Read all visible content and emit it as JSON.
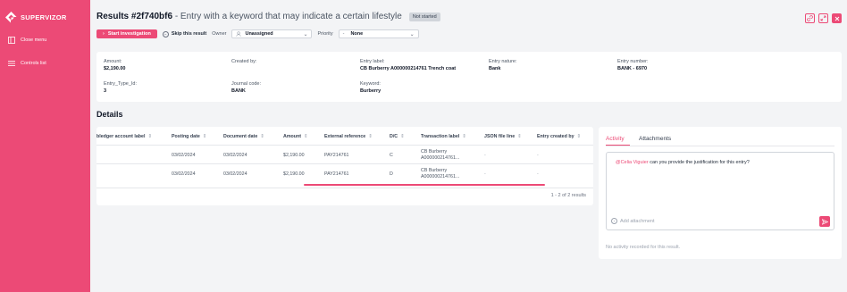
{
  "sidebar": {
    "brand": "SUPERVIZOR",
    "items": [
      {
        "label": "Close menu",
        "icon": "panel-close-icon"
      },
      {
        "label": "Controls list",
        "icon": "list-icon"
      }
    ]
  },
  "header": {
    "title_id": "Results #2f740bf6",
    "title_desc": "- Entry with a keyword that may indicate a certain lifestyle",
    "status": "Not started"
  },
  "actions": {
    "start": "Start investigation",
    "skip": "Skip this result",
    "owner_label": "Owner",
    "owner_value": "Unassigned",
    "priority_label": "Priority",
    "priority_value": "None",
    "priority_dash": "-"
  },
  "info": {
    "amount_label": "Amount:",
    "amount": "$2,190.00",
    "created_by_label": "Created by:",
    "created_by": "",
    "entry_label_label": "Entry label:",
    "entry_label": "CB Burberry A000000214761 Trench coat",
    "entry_nature_label": "Entry nature:",
    "entry_nature": "Bank",
    "entry_number_label": "Entry number:",
    "entry_number": "BANK - 6970",
    "entry_type_label": "Entry_Type_Id:",
    "entry_type": "3",
    "journal_code_label": "Journal code:",
    "journal_code": "BANK",
    "keyword_label": "Keyword:",
    "keyword": "Burberry"
  },
  "details": {
    "title": "Details",
    "columns": [
      "bledger account label",
      "Posting date",
      "Document date",
      "Amount",
      "External reference",
      "D/C",
      "Transaction label",
      "JSON file line",
      "Entry created by"
    ],
    "rows": [
      {
        "ledger": "",
        "posting": "03/02/2024",
        "document": "03/02/2024",
        "amount": "$2,190.00",
        "ext_ref": "PAY214761",
        "dc": "C",
        "label1": "CB Burberry",
        "label2": "A000000214761...",
        "json": "-",
        "created": "-"
      },
      {
        "ledger": "",
        "posting": "03/02/2024",
        "document": "03/02/2024",
        "amount": "$2,190.00",
        "ext_ref": "PAY214761",
        "dc": "D",
        "label1": "CB Burberry",
        "label2": "A000000214761...",
        "json": "-",
        "created": "-"
      }
    ],
    "pagination": "1 - 2 of 2 results"
  },
  "activity": {
    "tabs": [
      "Activity",
      "Attachments"
    ],
    "mention": "@Celia Viguier",
    "comment": " can you provide the justification for this entry?",
    "add_attachment": "Add attachment",
    "empty": "No activity recorded for this result."
  },
  "colors": {
    "accent": "#ec4a76",
    "background": "#f3f4f6",
    "card": "#ffffff"
  }
}
